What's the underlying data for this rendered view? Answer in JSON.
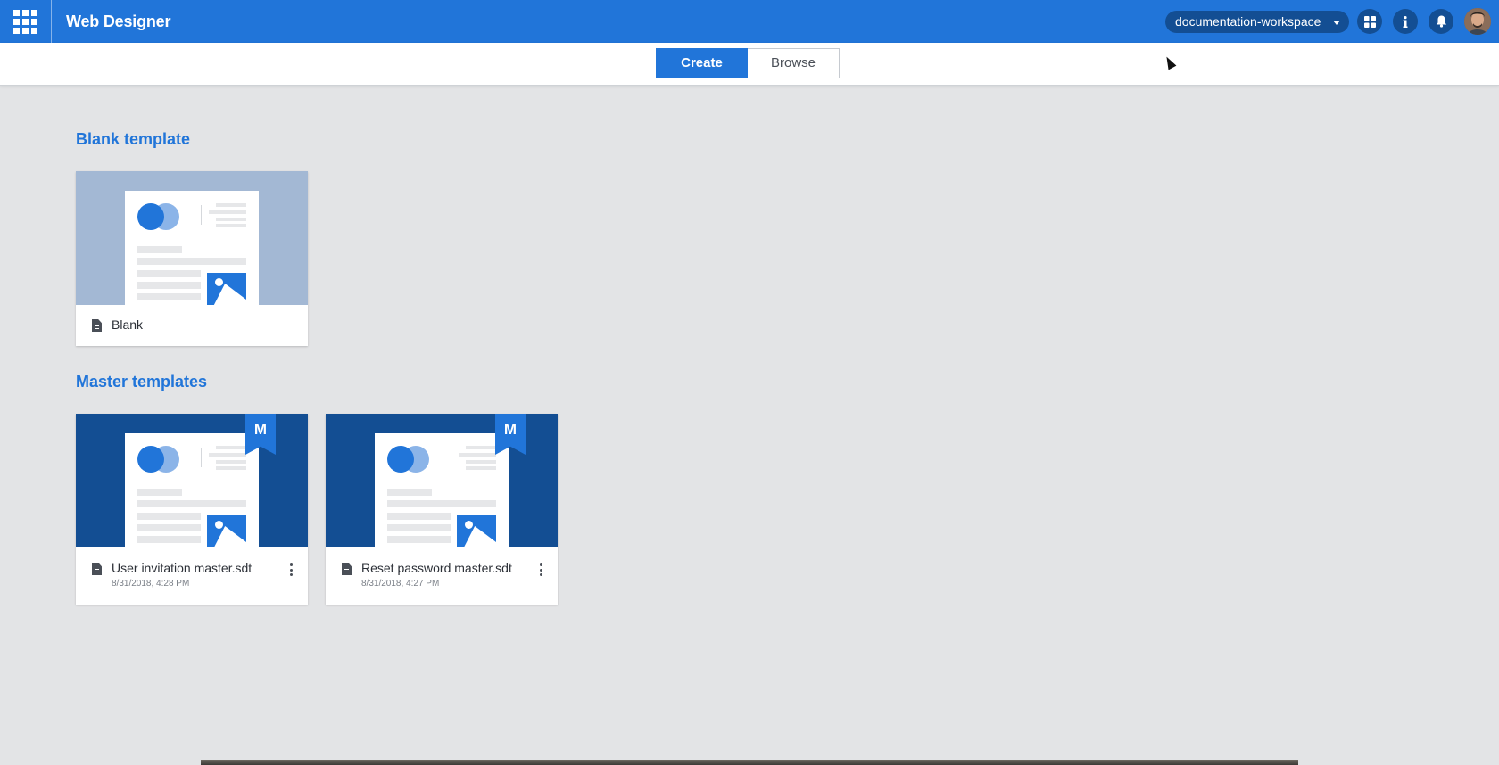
{
  "header": {
    "app_title": "Web Designer",
    "workspace": "documentation-workspace",
    "icons": [
      "apps-grid-icon",
      "dashboard-icon",
      "info-icon",
      "bell-icon",
      "avatar"
    ],
    "accent_color": "#2175d9",
    "dark_accent_color": "#134e93"
  },
  "tabs": {
    "create": "Create",
    "browse": "Browse",
    "selected": "Create"
  },
  "blank_section": {
    "title": "Blank template",
    "cards": [
      {
        "name": "Blank"
      }
    ]
  },
  "master_section": {
    "title": "Master templates",
    "badge": "M",
    "cards": [
      {
        "name": "User invitation master.sdt",
        "date": "8/31/2018, 4:28 PM"
      },
      {
        "name": "Reset password master.sdt",
        "date": "8/31/2018, 4:27 PM"
      }
    ]
  }
}
